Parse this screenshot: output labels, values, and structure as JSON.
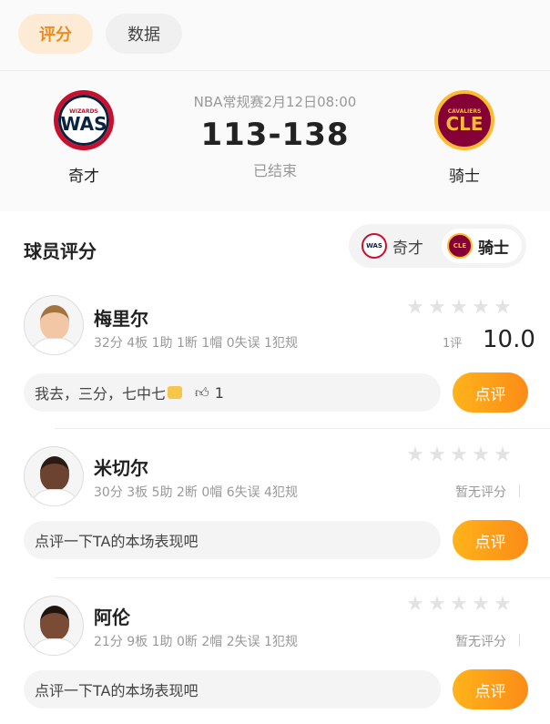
{
  "tabs": {
    "rating": "评分",
    "data": "数据"
  },
  "match": {
    "info": "NBA常规赛2月12日08:00",
    "score": "113-138",
    "status": "已结束",
    "home": {
      "name": "奇才",
      "logo_text": "WAS",
      "logo_sub": "WIZARDS",
      "color": "#c8102e"
    },
    "away": {
      "name": "骑士",
      "logo_text": "CLE",
      "logo_sub": "CAVALIERS",
      "color": "#860038"
    }
  },
  "rating": {
    "title": "球员评分",
    "switch": {
      "was_label": "奇才",
      "cle_label": "骑士",
      "was_logo": "WAS",
      "cle_logo": "CLE",
      "selected": "骑士"
    },
    "comment_button": "点评",
    "players": [
      {
        "name": "梅里尔",
        "stats": "32分 4板 1助 1断 1帽 0失误 1犯规",
        "rating_count": "1评",
        "rating_value": "10.0",
        "comment": "我去，三分，七中七",
        "likes": "1",
        "avatar_skin": "#f1c7a6",
        "avatar_hair": "#a3743f"
      },
      {
        "name": "米切尔",
        "stats": "30分 3板 5助 2断 0帽 6失误 4犯规",
        "no_rating": "暂无评分",
        "comment_placeholder": "点评一下TA的本场表现吧",
        "avatar_skin": "#6b4330",
        "avatar_hair": "#2a1a12"
      },
      {
        "name": "阿伦",
        "stats": "21分 9板 1助 0断 2帽 2失误 1犯规",
        "no_rating": "暂无评分",
        "comment_placeholder": "点评一下TA的本场表现吧",
        "avatar_skin": "#7a4c35",
        "avatar_hair": "#1e1410"
      }
    ]
  }
}
